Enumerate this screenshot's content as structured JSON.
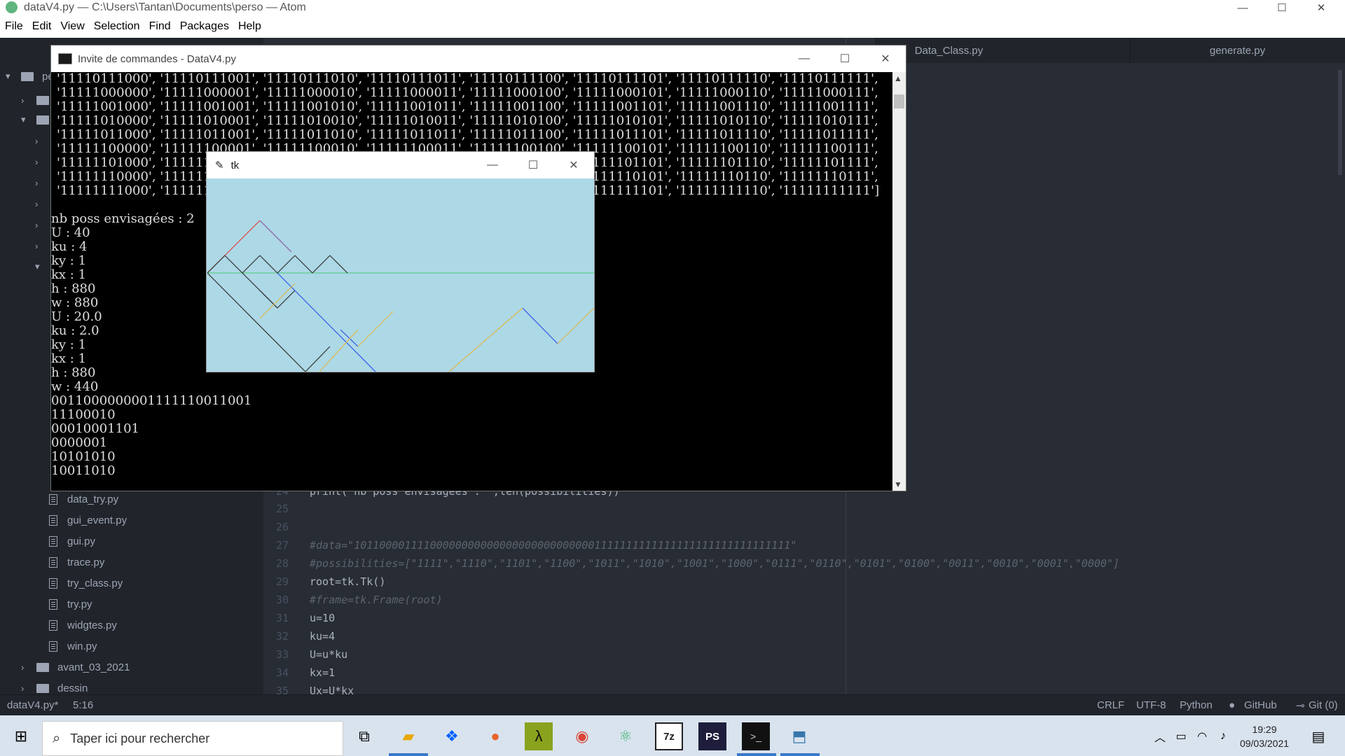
{
  "atom": {
    "window_title": "dataV4.py — C:\\Users\\Tantan\\Documents\\perso — Atom",
    "menu": [
      "File",
      "Edit",
      "View",
      "Selection",
      "Find",
      "Packages",
      "Help"
    ],
    "tabs": [
      "Data_Class.py",
      "generate.py"
    ],
    "tree": {
      "root_label": "pe",
      "files": [
        "data_try.py",
        "gui_event.py",
        "gui.py",
        "trace.py",
        "try_class.py",
        "try.py",
        "widgtes.py",
        "win.py"
      ],
      "folders": [
        "avant_03_2021",
        "dessin"
      ]
    },
    "code_lines": [
      {
        "n": "24",
        "t": "print(\"nb poss envisagées : \",len(possibilities))"
      },
      {
        "n": "25",
        "t": ""
      },
      {
        "n": "26",
        "t": ""
      },
      {
        "n": "27",
        "t": "#data=\"101100001111000000000000000000000000001111111111111111111111111111111\""
      },
      {
        "n": "28",
        "t": "#possibilities=[\"1111\",\"1110\",\"1101\",\"1100\",\"1011\",\"1010\",\"1001\",\"1000\",\"0111\",\"0110\",\"0101\",\"0100\",\"0011\",\"0010\",\"0001\",\"0000\"]"
      },
      {
        "n": "29",
        "t": "root=tk.Tk()"
      },
      {
        "n": "30",
        "t": "#frame=tk.Frame(root)"
      },
      {
        "n": "31",
        "t": "u=10"
      },
      {
        "n": "32",
        "t": "ku=4"
      },
      {
        "n": "33",
        "t": "U=u*ku"
      },
      {
        "n": "34",
        "t": "kx=1"
      },
      {
        "n": "35",
        "t": "Ux=U*kx"
      }
    ],
    "status": {
      "file": "dataV4.py*",
      "pos": "5:16",
      "eol": "CRLF",
      "enc": "UTF-8",
      "grammar": "Python",
      "github": "GitHub",
      "git": "Git (0)"
    }
  },
  "cmd": {
    "title": "Invite de commandes - DataV4.py",
    "lines": [
      "'11110111000', '11110111001', '11110111010', '11110111011', '11110111100', '11110111101', '11110111110', '11110111111',",
      "'11111000000', '11111000001', '11111000010', '11111000011', '11111000100', '11111000101', '11111000110', '11111000111',",
      "'11111001000', '11111001001', '11111001010', '11111001011', '11111001100', '11111001101', '11111001110', '11111001111',",
      "'11111010000', '11111010001', '11111010010', '11111010011', '11111010100', '11111010101', '11111010110', '11111010111',",
      "'11111011000', '11111011001', '11111011010', '11111011011', '11111011100', '11111011101', '11111011110', '11111011111',",
      "'11111100000', '11111100001', '11111100010', '11111100011', '11111100100', '11111100101', '11111100110', '11111100111',",
      "'11111101000', '11111101001', '11111101010', '11111101011', '11111101100', '11111101101', '11111101110', '11111101111',",
      "'11111110000', '11111110001', '11111110010', '11111110011', '11111110100', '11111110101', '11111110110', '11111110111',",
      "'11111111000', '11111111001', '11111111010', '11111111011', '11111111100', '11111111101', '11111111110', '11111111111']",
      "",
      "nb poss envisagées : 2",
      "U : 40",
      "ku : 4",
      "ky : 1",
      "kx : 1",
      "h : 880",
      "w : 880",
      "U : 20.0",
      "ku : 2.0",
      "ky : 1",
      "kx : 1",
      "h : 880",
      "w : 440",
      "0011000000001111110011001",
      "11100010",
      "00010001101",
      "0000001",
      "10101010",
      "10011010"
    ]
  },
  "tk": {
    "title": "tk",
    "bg": "#add8e6"
  },
  "taskbar": {
    "search_placeholder": "Taper ici pour rechercher",
    "time": "19:29",
    "date": "09/03/2021"
  },
  "colors": {
    "accent": "#3a79c9",
    "tk_red": "#e0423a",
    "tk_blue": "#2a55e8",
    "tk_gold": "#e0b84a",
    "tk_green": "#5ecf8a",
    "tk_dark": "#333333"
  }
}
